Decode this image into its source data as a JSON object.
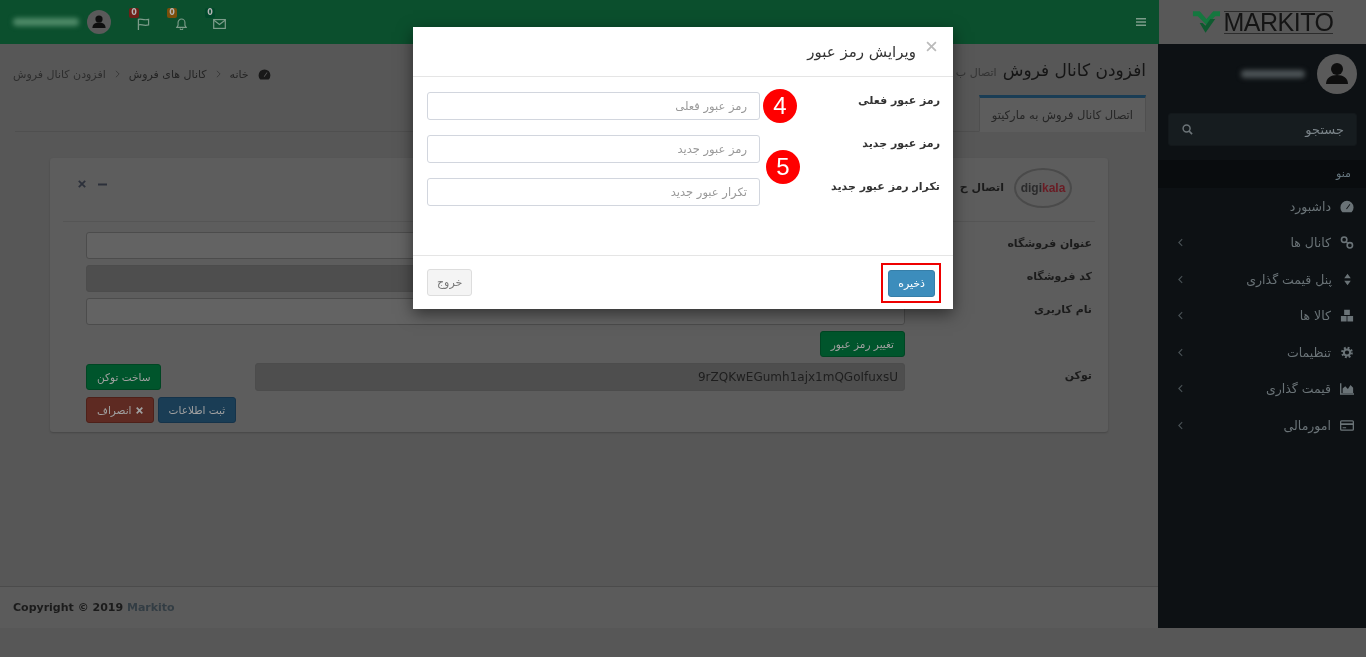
{
  "topbar": {
    "notifications": [
      {
        "count": "0",
        "color": "#00482a"
      },
      {
        "count": "0",
        "color": "#7a4e0a"
      },
      {
        "count": "0",
        "color": "#6e1f17"
      }
    ]
  },
  "page_header": {
    "title": "افزودن کانال فروش",
    "subtitle": "اتصال ب"
  },
  "breadcrumb": [
    {
      "label": "خانه"
    },
    {
      "label": "کانال های فروش"
    },
    {
      "label": "افزودن کانال فروش"
    }
  ],
  "tabs": [
    {
      "label": "اتصال کانال فروش به مارکیتو",
      "selected": true
    }
  ],
  "card": {
    "logo": {
      "text": "digi",
      "accent": "kala"
    },
    "title": "اتصال ح",
    "fields": [
      {
        "label": "عنوان فروشگاه",
        "disabled": false
      },
      {
        "label": "کد فروشگاه",
        "disabled": true
      },
      {
        "label": "نام کاربری",
        "disabled": false
      }
    ],
    "change_password_button": "تغییر رمز عبور",
    "token": {
      "label": "توکن",
      "value": "9rZQKwEGumh1ajx1mQGoIfuxsU",
      "disabled": true,
      "button": "ساخت توکن"
    },
    "actions": [
      {
        "label": "ثبت اطلاعات",
        "kind": "primary"
      },
      {
        "label": "انصراف",
        "kind": "danger"
      }
    ]
  },
  "footer": {
    "text": "Copyright © 2019",
    "link": "Markito"
  },
  "sidebar": {
    "logo": "MARKITO",
    "search": {
      "placeholder": "جستجو"
    },
    "menu_header": "منو",
    "items": [
      {
        "label": "داشبورد",
        "submenu": false
      },
      {
        "label": "کانال ها",
        "submenu": true
      },
      {
        "label": "پنل قیمت گذاری",
        "submenu": true
      },
      {
        "label": "کالا ها",
        "submenu": true
      },
      {
        "label": "تنظیمات",
        "submenu": true
      },
      {
        "label": "قیمت گذاری",
        "submenu": true
      },
      {
        "label": "امورمالی",
        "submenu": true
      }
    ]
  },
  "modal": {
    "title": "ویرایش رمز عبور",
    "fields": [
      {
        "label": "رمز عبور فعلی",
        "placeholder": "رمز عبور فعلی"
      },
      {
        "label": "رمز عبور جدید",
        "placeholder": "رمز عبور جدید"
      },
      {
        "label": "تکرار رمز عبور جدید",
        "placeholder": "تکرار عبور جدید"
      }
    ],
    "annotations": [
      {
        "label": "4"
      },
      {
        "label": "5"
      }
    ],
    "buttons": [
      {
        "label": "ذخیره",
        "kind": "primary",
        "highlighted": true
      },
      {
        "label": "خروج",
        "kind": "default",
        "highlighted": false
      }
    ]
  }
}
